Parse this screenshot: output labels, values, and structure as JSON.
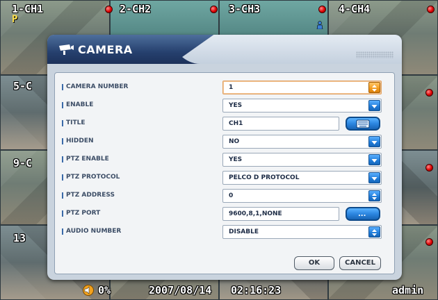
{
  "channels": [
    {
      "label": "1-CH1"
    },
    {
      "label": "2-CH2"
    },
    {
      "label": "3-CH3"
    },
    {
      "label": "4-CH4"
    },
    {
      "label": "5-C"
    },
    {
      "label": "9-C"
    },
    {
      "label": "13"
    }
  ],
  "channel1_badge": "P",
  "status_bar": {
    "volume": "0%",
    "date": "2007/08/14",
    "time": "02:16:23",
    "user": "admin"
  },
  "dialog": {
    "title": "CAMERA",
    "fields": [
      {
        "label": "CAMERA NUMBER",
        "value": "1",
        "control": "spinner",
        "focused": true
      },
      {
        "label": "ENABLE",
        "value": "YES",
        "control": "dropdown"
      },
      {
        "label": "TITLE",
        "value": "CH1",
        "control": "keyboard"
      },
      {
        "label": "HIDDEN",
        "value": "NO",
        "control": "dropdown"
      },
      {
        "label": "PTZ ENABLE",
        "value": "YES",
        "control": "dropdown"
      },
      {
        "label": "PTZ PROTOCOL",
        "value": "PELCO D PROTOCOL",
        "control": "dropdown"
      },
      {
        "label": "PTZ ADDRESS",
        "value": "0",
        "control": "spinner"
      },
      {
        "label": "PTZ PORT",
        "value": "9600,8,1,NONE",
        "control": "more"
      },
      {
        "label": "AUDIO NUMBER",
        "value": "DISABLE",
        "control": "spinner"
      }
    ],
    "ok_label": "OK",
    "cancel_label": "CANCEL",
    "more_label": "..."
  },
  "colors": {
    "header": "#26406e",
    "accent": "#1f7bd9",
    "focus": "#f39a1c",
    "record": "#dd0000"
  }
}
